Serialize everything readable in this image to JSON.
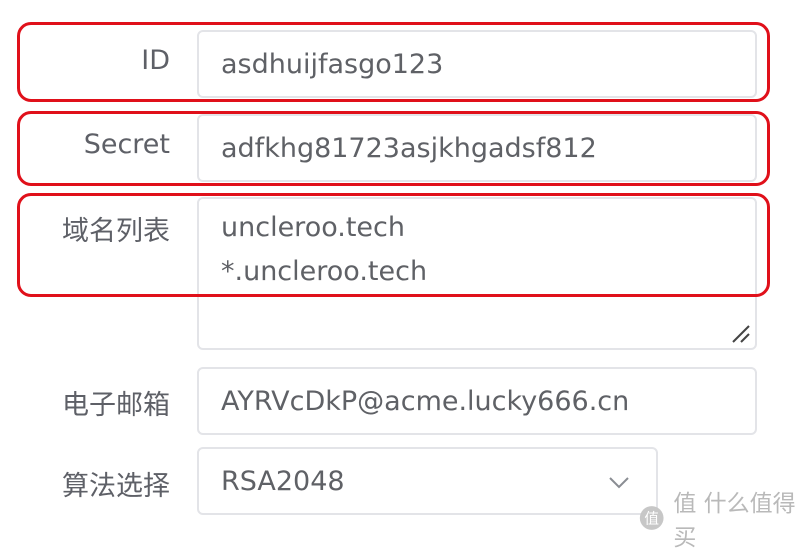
{
  "form": {
    "id": {
      "label": "ID",
      "value": "asdhuijfasgo123"
    },
    "secret": {
      "label": "Secret",
      "value": "adfkhg81723asjkhgadsf812"
    },
    "domains": {
      "label": "域名列表",
      "lines": [
        "uncleroo.tech",
        "*.uncleroo.tech"
      ]
    },
    "email": {
      "label": "电子邮箱",
      "value": "AYRVcDkP@acme.lucky666.cn"
    },
    "algorithm": {
      "label": "算法选择",
      "selected": "RSA2048",
      "icon": "chevron-down-icon"
    }
  },
  "watermark": {
    "text": "值 什么值得买",
    "icon": "zhi-logo-icon"
  },
  "colors": {
    "highlight": "#e0101a",
    "border": "#e3e4e8",
    "text": "#5f6166"
  }
}
